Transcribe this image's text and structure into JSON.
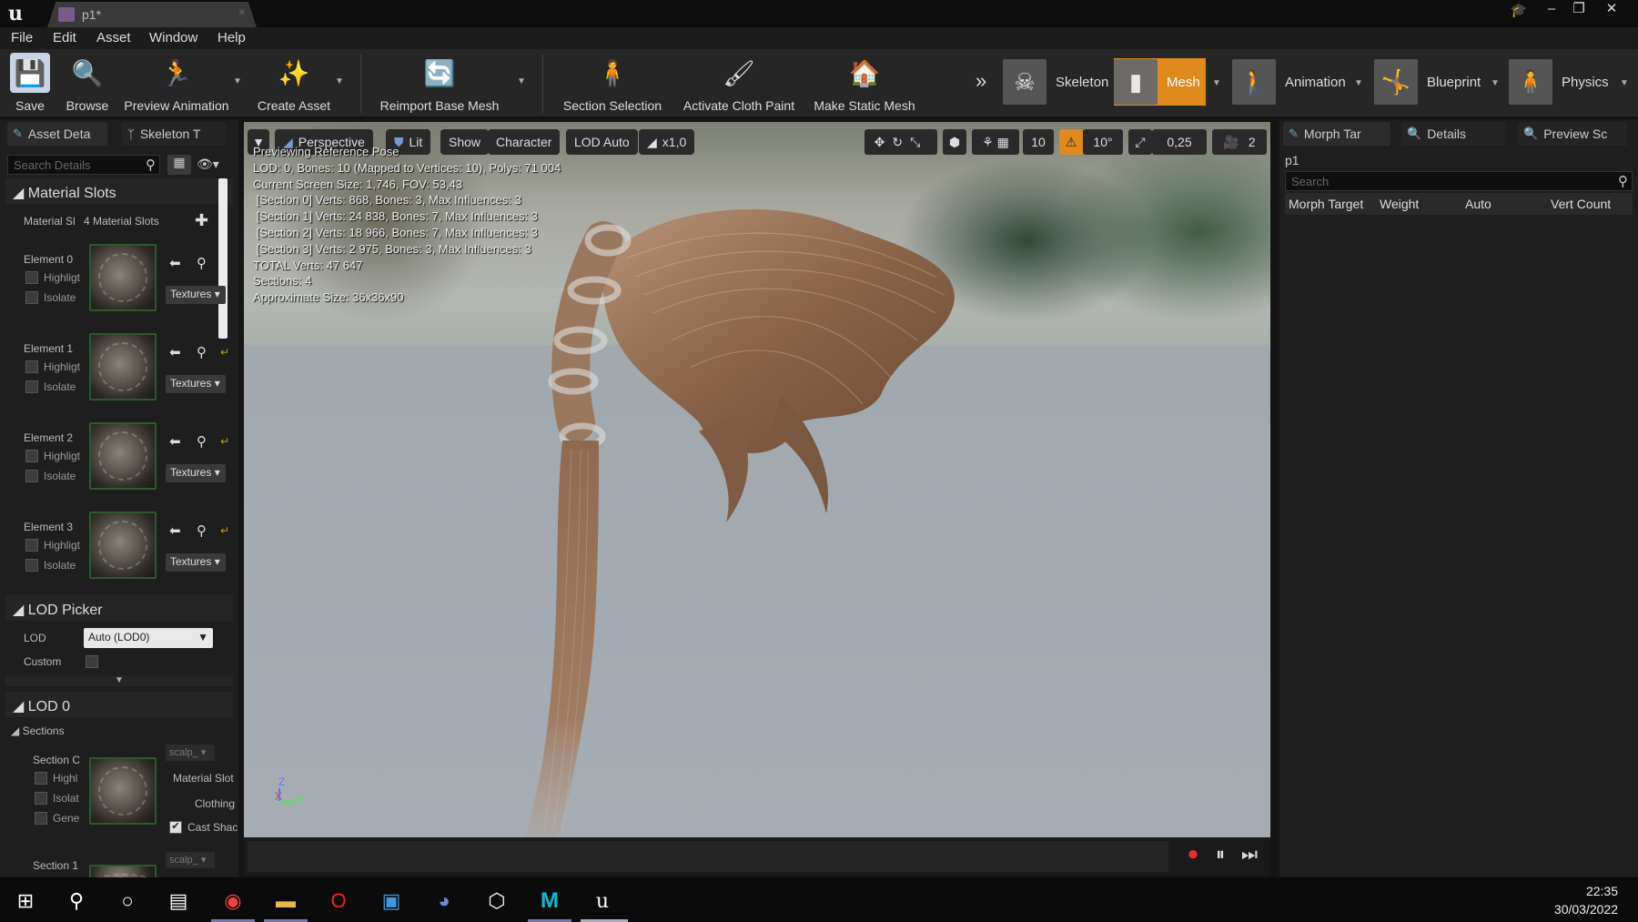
{
  "window": {
    "tab_title": "p1*",
    "controls": {
      "minimize": "–",
      "maximize": "❐",
      "close": "✕"
    }
  },
  "menu": [
    "File",
    "Edit",
    "Asset",
    "Window",
    "Help"
  ],
  "toolbar": {
    "buttons": [
      {
        "label": "Save",
        "icon": "save-icon"
      },
      {
        "label": "Browse",
        "icon": "browse-icon"
      },
      {
        "label": "Preview Animation",
        "icon": "preview-animation-icon"
      },
      {
        "label": "Create Asset",
        "icon": "create-asset-icon"
      },
      {
        "label": "Reimport Base Mesh",
        "icon": "reimport-icon"
      },
      {
        "label": "Section Selection",
        "icon": "section-selection-icon"
      },
      {
        "label": "Activate Cloth Paint",
        "icon": "cloth-paint-icon"
      },
      {
        "label": "Make Static Mesh",
        "icon": "static-mesh-icon"
      }
    ],
    "modes": [
      {
        "label": "Skeleton",
        "active": false
      },
      {
        "label": "Mesh",
        "active": true
      },
      {
        "label": "Animation",
        "active": false
      },
      {
        "label": "Blueprint",
        "active": false
      },
      {
        "label": "Physics",
        "active": false
      }
    ],
    "active_color": "#e08a1e"
  },
  "left_panel": {
    "tabs": [
      "Asset Deta",
      "Skeleton T"
    ],
    "search_placeholder": "Search Details",
    "material_slots": {
      "header": "Material Slots",
      "row_label": "Material Sl",
      "count_label": "4 Material Slots",
      "elements": [
        {
          "label": "Element 0",
          "highlight": "Highligt",
          "isolate": "Isolate",
          "button": "Textures"
        },
        {
          "label": "Element 1",
          "highlight": "Highligt",
          "isolate": "Isolate",
          "button": "Textures"
        },
        {
          "label": "Element 2",
          "highlight": "Highligt",
          "isolate": "Isolate",
          "button": "Textures"
        },
        {
          "label": "Element 3",
          "highlight": "Highligt",
          "isolate": "Isolate",
          "button": "Textures"
        }
      ]
    },
    "lod_picker": {
      "header": "LOD Picker",
      "lod_label": "LOD",
      "lod_value": "Auto (LOD0)",
      "custom_label": "Custom"
    },
    "lod0": {
      "header": "LOD 0",
      "sections_label": "Sections",
      "section0_label": "Section C",
      "section0_dropdown": "scalp_",
      "checks": [
        "Highl",
        "Isolat",
        "Gene"
      ],
      "material_slot_label": "Material Slot",
      "clothing_label": "Clothing",
      "cast_shadow_label": "Cast Shac",
      "section1_label": "Section 1",
      "section1_dropdown": "scalp_"
    }
  },
  "viewport": {
    "buttons": {
      "perspective": "Perspective",
      "lit": "Lit",
      "show": "Show",
      "character": "Character",
      "lod": "LOD Auto",
      "speed": "x1,0"
    },
    "snap": {
      "grid": "10",
      "rotation": "10°",
      "scale": "0,25",
      "camera_speed": "2"
    },
    "stats": [
      "Previewing Reference Pose",
      "LOD: 0, Bones: 10 (Mapped to Vertices: 10), Polys: 71 004",
      "Current Screen Size: 1,746, FOV: 53,43",
      " [Section 0] Verts: 868, Bones: 3, Max Influences: 3",
      " [Section 1] Verts: 24 838, Bones: 7, Max Influences: 3",
      " [Section 2] Verts: 18 966, Bones: 7, Max Influences: 3",
      " [Section 3] Verts: 2 975, Bones: 3, Max Influences: 3",
      "TOTAL Verts: 47 647",
      "Sections: 4",
      "Approximate Size: 36x36x90"
    ],
    "axes": {
      "z": "Z",
      "x": "X",
      "y": "Y"
    }
  },
  "right_panel": {
    "tabs": [
      "Morph Tar",
      "Details",
      "Preview Sc"
    ],
    "asset_name": "p1",
    "search_placeholder": "Search",
    "columns": [
      "Morph Target",
      "Weight",
      "Auto",
      "Vert Count"
    ]
  },
  "taskbar": {
    "time": "22:35",
    "date": "30/03/2022"
  }
}
